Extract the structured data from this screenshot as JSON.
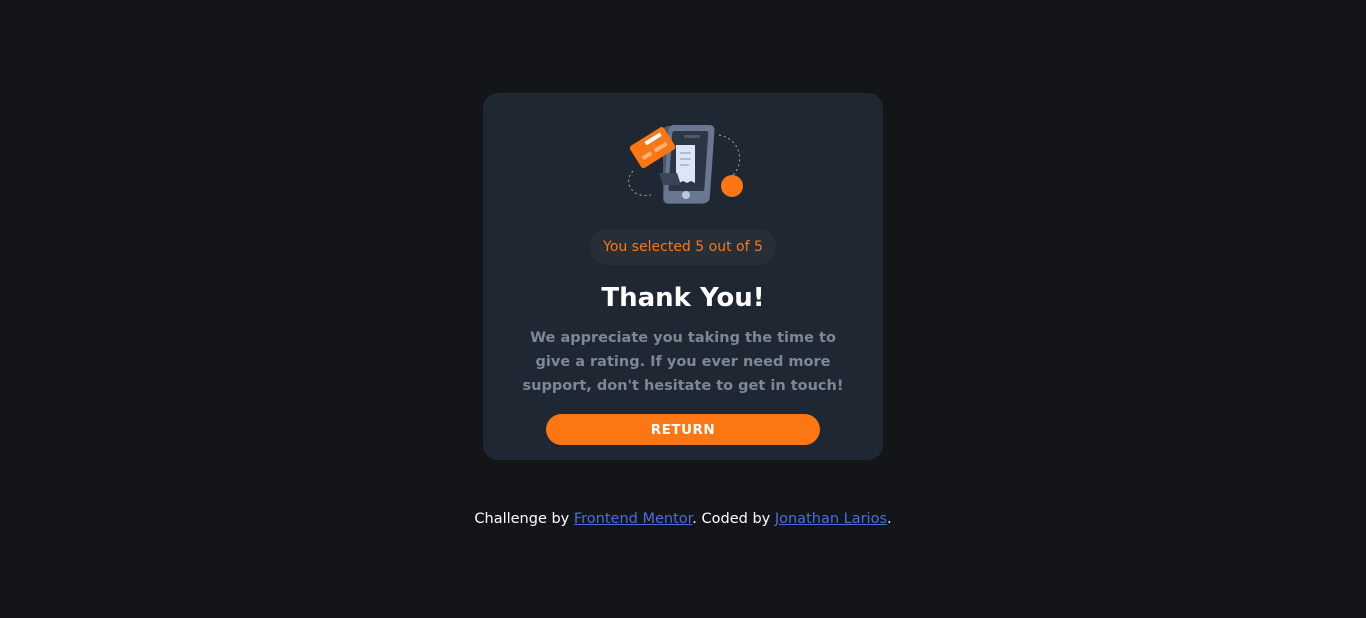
{
  "colors": {
    "background": "#131518",
    "card": "#1f2733",
    "accent": "#fc7614",
    "badge_bg": "#262e38",
    "muted_text": "#7c8798",
    "link": "#4a6ee0"
  },
  "card": {
    "illustration_icon": "payment-phone-illustration-icon",
    "badge_text": "You selected 5 out of 5",
    "title": "Thank You!",
    "message": "We appreciate you taking the time to give a rating. If you ever need more support, don't hesitate to get in touch!",
    "return_label": "RETURN"
  },
  "attribution": {
    "prefix": "Challenge by ",
    "challenge_link": "Frontend Mentor",
    "middle": ". Coded by ",
    "author_link": "Jonathan Larios",
    "suffix": "."
  }
}
